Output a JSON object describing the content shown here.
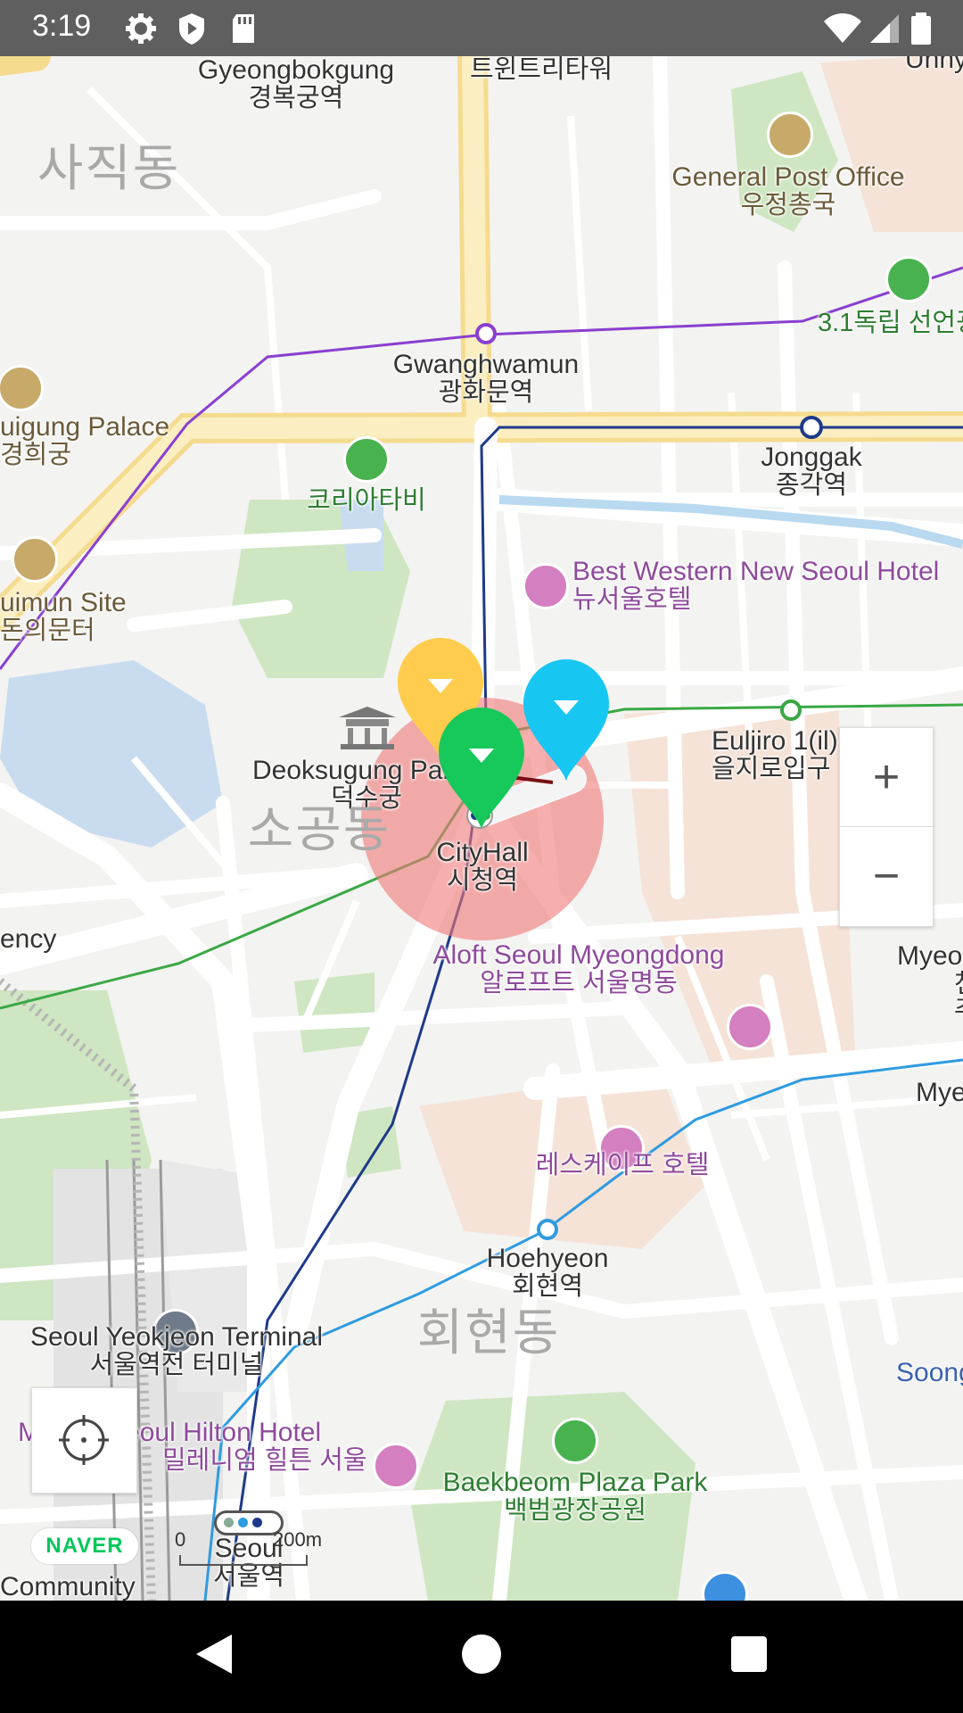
{
  "status_bar": {
    "time": "3:19",
    "icons": [
      "gear-icon",
      "shield-icon",
      "sd-card-icon",
      "wifi-icon",
      "signal-icon",
      "battery-icon"
    ]
  },
  "map": {
    "provider": "NAVER",
    "labels": {
      "gyeongbokgung": {
        "en": "Gyeongbokgung",
        "ko": "경복궁역"
      },
      "twin_tree": {
        "ko": "트윈트리타워"
      },
      "unhy": {
        "en": "Unhy"
      },
      "sajik": {
        "ko": "사직동"
      },
      "post_office": {
        "en": "General Post Office",
        "ko": "우정총국"
      },
      "independence": {
        "ko": "3.1독립 선언광"
      },
      "gwanghwamun": {
        "en": "Gwanghwamun",
        "ko": "광화문역"
      },
      "gyeonghuigung": {
        "en": "uigung Palace",
        "ko": "경희궁"
      },
      "jonggak": {
        "en": "Jonggak",
        "ko": "종각역"
      },
      "korea_tabi": {
        "ko": "코리아타비"
      },
      "donuimun": {
        "en": "uimun Site",
        "ko": "돈의문터"
      },
      "best_western": {
        "en": "Best Western New Seoul Hotel",
        "ko": "뉴서울호텔"
      },
      "deoksugung": {
        "en": "Deoksugung Pala",
        "ko": "덕수궁"
      },
      "sogong": {
        "ko": "소공동"
      },
      "euljiro": {
        "en": "Euljiro 1(il)-",
        "ko": "을지로입구"
      },
      "cityhall": {
        "en": "CityHall",
        "ko": "시청역"
      },
      "ency": {
        "en": "ency"
      },
      "aloft": {
        "en": "Aloft Seoul Myeongdong",
        "ko": "알로프트 서울명동"
      },
      "myeong1": {
        "en": "Myeo",
        "ko": "천"
      },
      "myeong_ju": {
        "ko": "주"
      },
      "mye2": {
        "en": "Mye"
      },
      "lescape": {
        "ko": "레스케이프 호텔"
      },
      "hoehyeon": {
        "en": "Hoehyeon",
        "ko": "회현역"
      },
      "hoehyeon_dong": {
        "ko": "회현동"
      },
      "terminal": {
        "en": "Seoul Yeokjeon Terminal",
        "ko": "서울역전 터미널"
      },
      "soong": {
        "en": "Soong"
      },
      "hilton": {
        "en": "M      n Seoul Hilton Hotel",
        "ko": "밀레니엄 힐튼 서울"
      },
      "baekbeom": {
        "en": "Baekbeom Plaza Park",
        "ko": "백범광장공원"
      },
      "seoul_station": {
        "en": "Seoul",
        "ko": "서울역"
      },
      "community": {
        "en": "Community"
      }
    },
    "scale": {
      "start": "0",
      "end": "200m"
    },
    "markers": [
      {
        "color": "#ffcc4d",
        "icon": "map-pin-icon"
      },
      {
        "color": "#17c85a",
        "icon": "map-pin-icon"
      },
      {
        "color": "#18c6f2",
        "icon": "map-pin-icon"
      }
    ],
    "location_circle_color": "#f08080",
    "zoom": {
      "plus": "+",
      "minus": "−"
    }
  },
  "colors": {
    "line_purple": "#8a3fd0",
    "line_navy": "#1e3a8a",
    "line_green": "#3aa845",
    "line_skyblue": "#2f9be0",
    "main_road": "#f8e7a6"
  }
}
